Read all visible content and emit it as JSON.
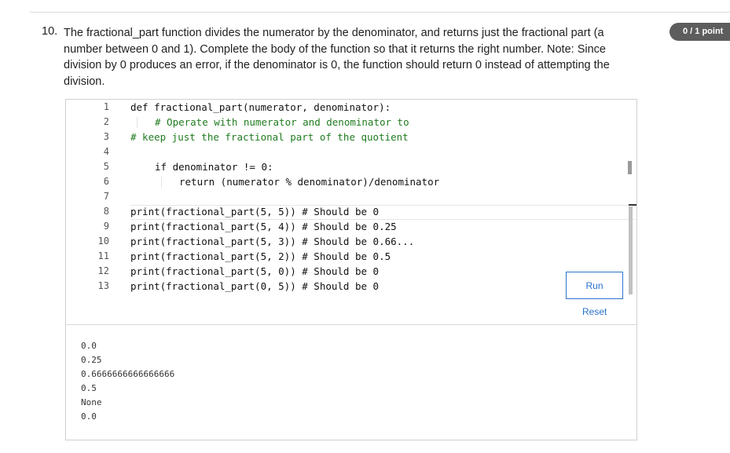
{
  "question": {
    "number": "10.",
    "text": "The fractional_part function divides the numerator by the denominator, and returns just the fractional part (a number between 0 and 1). Complete the body of the function so that it returns the right number. Note: Since division by 0 produces an error, if the denominator is 0, the function should return 0 instead of attempting the division.",
    "points": "0 / 1 point"
  },
  "editor": {
    "line_numbers": [
      "1",
      "2",
      "3",
      "4",
      "5",
      "6",
      "7",
      "8",
      "9",
      "10",
      "11",
      "12",
      "13"
    ],
    "lines": [
      "def fractional_part(numerator, denominator):",
      "# Operate with numerator and denominator to",
      "# keep just the fractional part of the quotient",
      "",
      "if denominator != 0:",
      "return (numerator % denominator)/denominator",
      "",
      "print(fractional_part(5, 5)) # Should be 0",
      "print(fractional_part(5, 4)) # Should be 0.25",
      "print(fractional_part(5, 3)) # Should be 0.66...",
      "print(fractional_part(5, 2)) # Should be 0.5",
      "print(fractional_part(5, 0)) # Should be 0",
      "print(fractional_part(0, 5)) # Should be 0"
    ]
  },
  "actions": {
    "run_label": "Run",
    "reset_label": "Reset"
  },
  "output": [
    "0.0",
    "0.25",
    "0.6666666666666666",
    "0.5",
    "None",
    "0.0"
  ]
}
